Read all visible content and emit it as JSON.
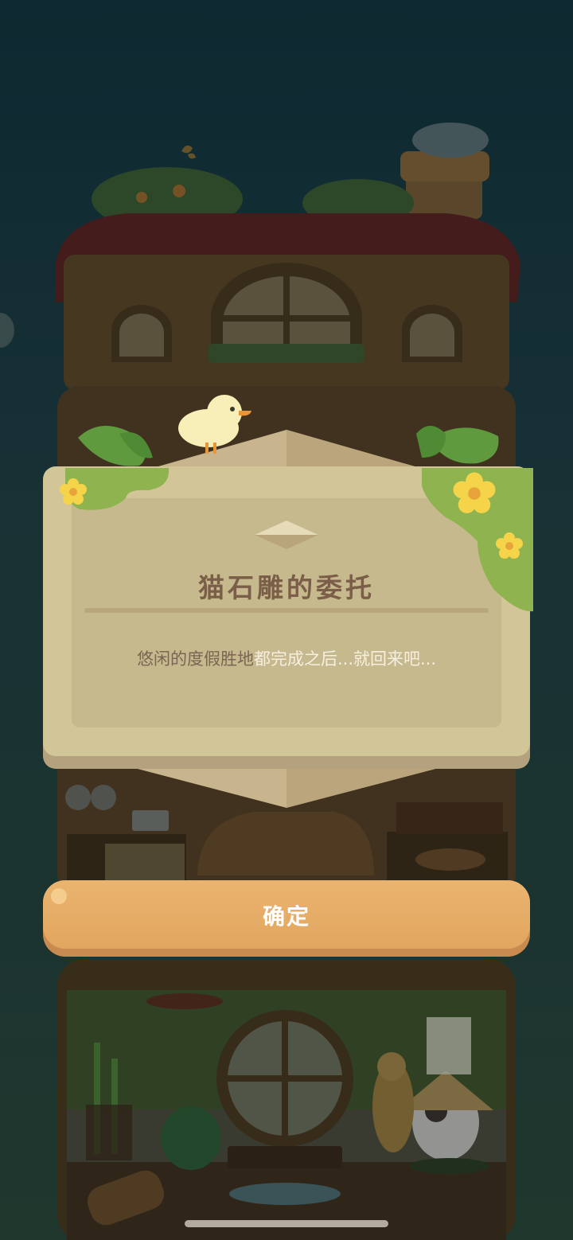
{
  "dialog": {
    "title": "猫石雕的委托",
    "message_muted": "悠闲的度假胜地",
    "message_highlight": "都完成之后...就回来吧..."
  },
  "buttons": {
    "confirm_label": "确定"
  },
  "colors": {
    "panel": "#d2c598",
    "panel_inner": "#c7b98e",
    "title_text": "#7a5e48",
    "button": "#e1a660",
    "leaf_green": "#8fb34e",
    "flower_yellow": "#f6d44a"
  },
  "icons": {
    "duck": "duck-mascot-icon",
    "flower": "yellow-flower-icon",
    "gem": "diamond-ornament-icon"
  }
}
